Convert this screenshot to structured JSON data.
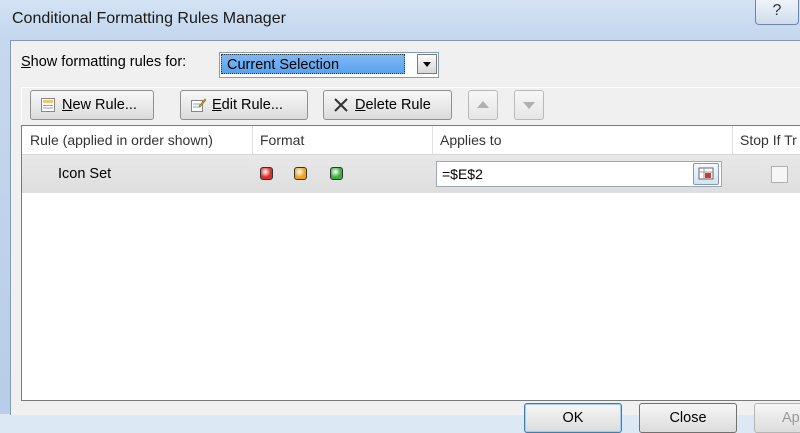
{
  "window": {
    "title": "Conditional Formatting Rules Manager",
    "help_label": "?"
  },
  "show_rules": {
    "label_mnemonic": "S",
    "label_rest": "how formatting rules for:",
    "selected": "Current Selection"
  },
  "toolbar": {
    "new_rule_mnemonic": "N",
    "new_rule_rest": "ew Rule...",
    "edit_rule_mnemonic": "E",
    "edit_rule_rest": "dit Rule...",
    "delete_rule_mnemonic": "D",
    "delete_rule_rest": "elete Rule"
  },
  "grid": {
    "headers": {
      "rule": "Rule (applied in order shown)",
      "format": "Format",
      "applies_to": "Applies to",
      "stop_if_true": "Stop If Tr"
    },
    "rows": [
      {
        "rule": "Icon Set",
        "applies_to": "=$E$2",
        "icon_colors": [
          "#d9302b",
          "#f0a21b",
          "#3aae3a"
        ],
        "stop_if_true": false
      }
    ]
  },
  "footer": {
    "ok": "OK",
    "close": "Close",
    "apply": "Ap"
  },
  "colors": {
    "selection": "#5aa2ee",
    "dialog_bg": "#f0f0f0"
  }
}
